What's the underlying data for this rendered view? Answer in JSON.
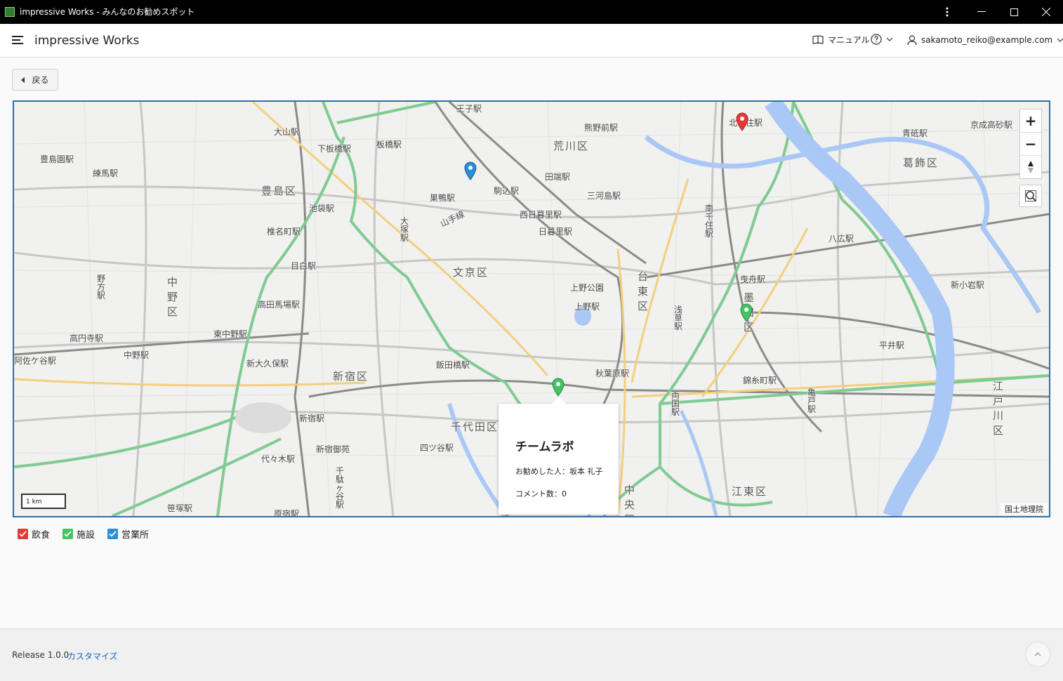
{
  "window": {
    "title": "impressive Works - みんなのお勧めスポット"
  },
  "header": {
    "brand": "impressive Works",
    "manual_label": "マニュアル",
    "user_email": "sakamoto_reiko@example.com"
  },
  "back_button": {
    "label": "戻る"
  },
  "map": {
    "scale_label": "1 km",
    "attribution": "国土地理院",
    "ward_labels": [
      "荒川区",
      "葛飾区",
      "豊島区",
      "文京区",
      "台東区",
      "墨田区",
      "中野区",
      "新宿区",
      "千代田区",
      "江東区",
      "江戸川区",
      "中央区"
    ],
    "station_labels": [
      "王子駅",
      "大山駅",
      "板橋駅",
      "下板橋駅",
      "熊野前駅",
      "北千住駅",
      "青砥駅",
      "京成高砂駅",
      "豊島園駅",
      "練馬駅",
      "田端駅",
      "三河島駅",
      "駒込駅",
      "巣鴨駅",
      "池袋駅",
      "西日暮里駅",
      "日暮里駅",
      "椎名町駅",
      "大塚駅",
      "南千住駅",
      "八広駅",
      "目白駅",
      "上野公園",
      "上野駅",
      "曳舟駅",
      "新小岩駅",
      "高田馬場駅",
      "東中野駅",
      "浅草駅",
      "平井駅",
      "高円寺駅",
      "中野駅",
      "新大久保駅",
      "飯田橋駅",
      "秋葉原駅",
      "錦糸町駅",
      "阿佐ケ谷駅",
      "新宿駅",
      "両国駅",
      "亀戸駅",
      "新宿御苑",
      "四ツ谷駅",
      "代々木駅",
      "千駄ヶ谷駅",
      "笹塚駅",
      "原宿駅",
      "野方駅",
      "山手線"
    ],
    "popup": {
      "title": "チームラボ",
      "recommender_label": "お勧めした人：",
      "recommender": "坂本 礼子",
      "comments_label": "コメント数：",
      "comments": "0"
    },
    "markers": [
      {
        "category": "営業所",
        "color": "#2b8fd6"
      },
      {
        "category": "飲食",
        "color": "#e53935"
      },
      {
        "category": "施設",
        "color": "#43c463"
      },
      {
        "category": "施設",
        "color": "#43c463"
      }
    ]
  },
  "legend": [
    {
      "label": "飲食",
      "color": "#e53935",
      "checked": true
    },
    {
      "label": "施設",
      "color": "#43c463",
      "checked": true
    },
    {
      "label": "営業所",
      "color": "#2b8fd6",
      "checked": true
    }
  ],
  "footer": {
    "release": "Release 1.0.0",
    "customize_link": "カスタマイズ"
  }
}
